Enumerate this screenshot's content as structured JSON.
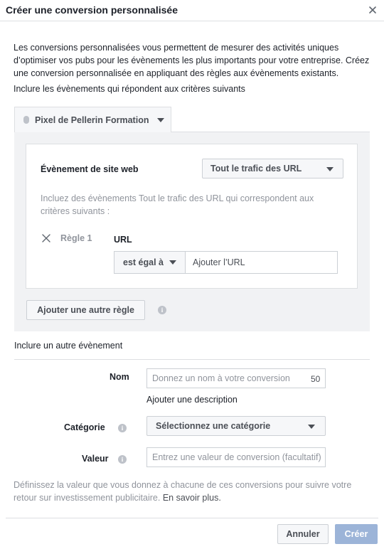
{
  "dialog": {
    "title": "Créer une conversion personnalisée",
    "close_icon": "close-icon"
  },
  "intro": {
    "text": "Les conversions personnalisées vous permettent de mesurer des activités uniques d’optimiser vos pubs pour les évènements les plus importants pour votre entreprise. Créez une conversion personnalisée en appliquant des règles aux évènements existants.",
    "include_label": "Inclure les évènements qui répondent aux critères suivants"
  },
  "pixel": {
    "label": "Pixel de Pellerin Formation",
    "dot_color": "#bec2c9"
  },
  "rules_panel": {
    "event_label": "Évènement de site web",
    "event_value": "Tout le trafic des URL",
    "description": "Incluez des évènements Tout le trafic des URL qui correspondent aux critères suivants :",
    "rule": {
      "label": "Règle 1",
      "field": "URL",
      "operator": "est égal à",
      "input_placeholder": "Ajouter l’URL",
      "input_value": ""
    },
    "add_rule_label": "Ajouter une autre règle"
  },
  "add_other_event": "Inclure un autre évènement",
  "form": {
    "name": {
      "label": "Nom",
      "placeholder": "Donnez un nom à votre conversion",
      "value": "",
      "char_count": "50",
      "add_description": "Ajouter une description"
    },
    "category": {
      "label": "Catégorie",
      "selected": "Sélectionnez une catégorie"
    },
    "value": {
      "label": "Valeur",
      "placeholder": "Entrez une valeur de conversion (facultatif)",
      "value": ""
    }
  },
  "footer": {
    "text": "Définissez la valeur que vous donnez à chacune de ces conversions pour suivre votre retour sur investissement publicitaire.",
    "learn_more": "En savoir plus."
  },
  "buttons": {
    "cancel": "Annuler",
    "create": "Créer"
  },
  "colors": {
    "create_button_disabled": "#9cb4d8",
    "panel_background": "#f1f2f4",
    "border": "#dddfe2"
  }
}
